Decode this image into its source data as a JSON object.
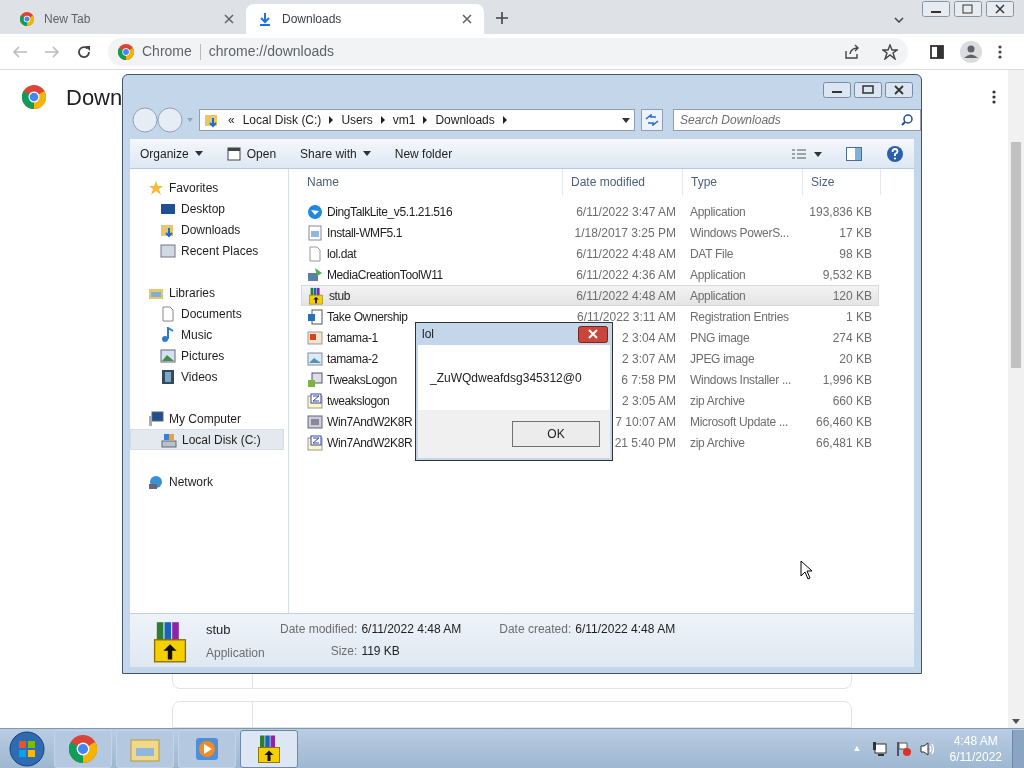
{
  "browser": {
    "tabs": [
      {
        "label": "New Tab",
        "selected": false,
        "kind": "newtab"
      },
      {
        "label": "Downloads",
        "selected": true,
        "kind": "download"
      }
    ],
    "address": {
      "site_chip": "Chrome",
      "url": "chrome://downloads"
    },
    "page": {
      "heading": "Down"
    }
  },
  "explorer": {
    "breadcrumbs": [
      "«",
      "Local Disk (C:)",
      "Users",
      "vm1",
      "Downloads"
    ],
    "search": {
      "placeholder": "Search Downloads"
    },
    "toolbar": [
      {
        "label": "Organize",
        "kind": "menu"
      },
      {
        "label": "Open",
        "kind": "open"
      },
      {
        "label": "Share with",
        "kind": "menu"
      },
      {
        "label": "New folder",
        "kind": "plain"
      }
    ],
    "sidebar": [
      {
        "label": "Favorites",
        "kind": "star",
        "selected": false,
        "children": [
          {
            "label": "Desktop",
            "kind": "desktop",
            "selected": false
          },
          {
            "label": "Downloads",
            "kind": "folder",
            "selected": false
          },
          {
            "label": "Recent Places",
            "kind": "recent",
            "selected": false
          }
        ]
      },
      {
        "label": "Libraries",
        "kind": "library",
        "selected": false,
        "children": [
          {
            "label": "Documents",
            "kind": "doc",
            "selected": false
          },
          {
            "label": "Music",
            "kind": "music",
            "selected": false
          },
          {
            "label": "Pictures",
            "kind": "pictures",
            "selected": false
          },
          {
            "label": "Videos",
            "kind": "video",
            "selected": false
          }
        ]
      },
      {
        "label": "My Computer",
        "kind": "computer",
        "selected": false,
        "children": [
          {
            "label": "Local Disk (C:)",
            "kind": "disk",
            "selected": true
          }
        ]
      },
      {
        "label": "Network",
        "kind": "network",
        "selected": false
      }
    ],
    "columns": [
      "Name",
      "Date modified",
      "Type",
      "Size"
    ],
    "rows": [
      {
        "name": "DingTalkLite_v5.1.21.516",
        "date": "6/11/2022 3:47 AM",
        "type": "Application",
        "size": "193,836 KB",
        "kind": "app",
        "selected": false
      },
      {
        "name": "Install-WMF5.1",
        "date": "1/18/2017 3:25 PM",
        "type": "Windows PowerS...",
        "size": "17 KB",
        "kind": "script",
        "selected": false
      },
      {
        "name": "lol.dat",
        "date": "6/11/2022 4:48 AM",
        "type": "DAT File",
        "size": "98 KB",
        "kind": "file",
        "selected": false
      },
      {
        "name": "MediaCreationToolW11",
        "date": "6/11/2022 4:36 AM",
        "type": "Application",
        "size": "9,532 KB",
        "kind": "setup",
        "selected": false
      },
      {
        "name": "stub",
        "date": "6/11/2022 4:48 AM",
        "type": "Application",
        "size": "120 KB",
        "kind": "rar",
        "selected": true
      },
      {
        "name": "Take Ownership",
        "date": "6/11/2022 3:11 AM",
        "type": "Registration Entries",
        "size": "1 KB",
        "kind": "registry",
        "selected": false
      },
      {
        "name": "tamama-1",
        "date": "2 3:04 AM",
        "type": "PNG image",
        "size": "274 KB",
        "kind": "png",
        "selected": false
      },
      {
        "name": "tamama-2",
        "date": "2 3:07 AM",
        "type": "JPEG image",
        "size": "20 KB",
        "kind": "jpg",
        "selected": false
      },
      {
        "name": "TweaksLogon",
        "date": "6 7:58 PM",
        "type": "Windows Installer ...",
        "size": "1,996 KB",
        "kind": "msi",
        "selected": false
      },
      {
        "name": "tweakslogon",
        "date": "2 3:05 AM",
        "type": "zip Archive",
        "size": "660 KB",
        "kind": "zip",
        "selected": false
      },
      {
        "name": "Win7AndW2K8R",
        "date": "7 10:07 AM",
        "type": "Microsoft Update ...",
        "size": "66,460 KB",
        "kind": "update",
        "selected": false
      },
      {
        "name": "Win7AndW2K8R",
        "date": "21 5:40 PM",
        "type": "zip Archive",
        "size": "66,481 KB",
        "kind": "zip",
        "selected": false
      }
    ],
    "details": {
      "name": "stub",
      "type": "Application",
      "modified_label": "Date modified:",
      "modified": "6/11/2022 4:48 AM",
      "created_label": "Date created:",
      "created": "6/11/2022 4:48 AM",
      "size_label": "Size:",
      "size": "119 KB"
    }
  },
  "dialog": {
    "title": "lol",
    "message": "_ZuWQdweafdsg345312@0",
    "button": "OK"
  },
  "taskbar": {
    "apps": [
      {
        "kind": "chrome",
        "selected": false
      },
      {
        "kind": "explorer",
        "selected": false
      },
      {
        "kind": "media",
        "selected": false
      },
      {
        "kind": "rar",
        "selected": true
      }
    ],
    "tray_arrow": "▲",
    "time": "4:48 AM",
    "date": "6/11/2022"
  }
}
